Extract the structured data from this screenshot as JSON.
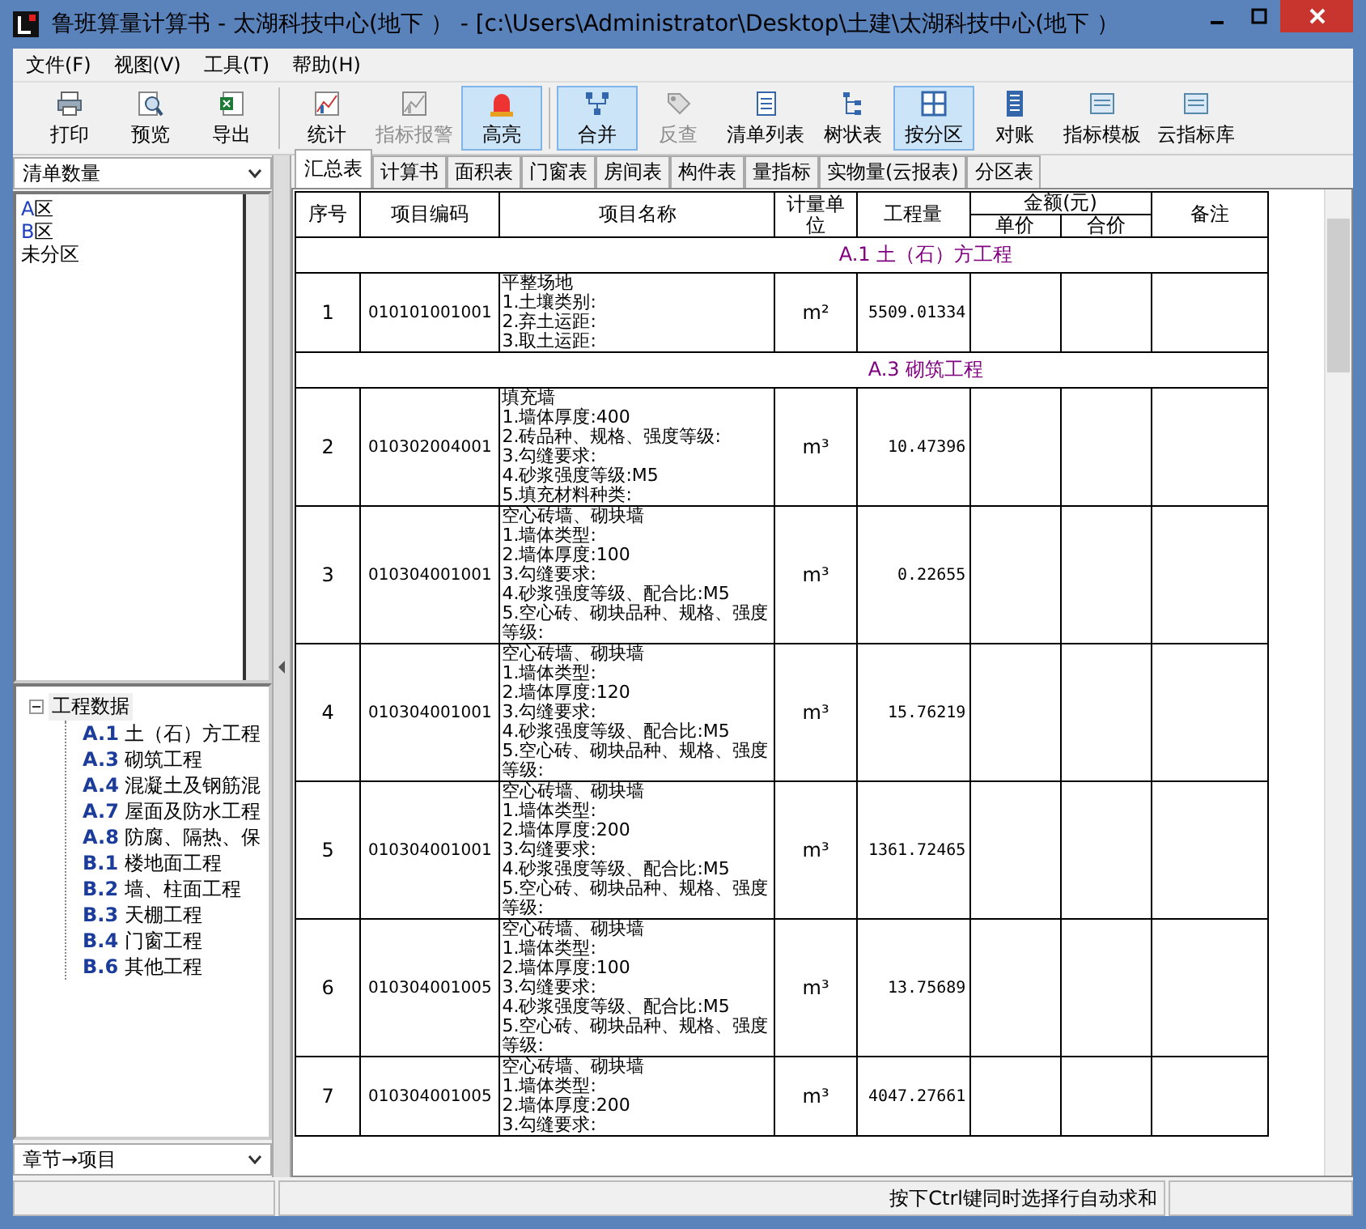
{
  "window": {
    "title": "鲁班算量计算书 - 太湖科技中心(地下 ）  - [c:\\Users\\Administrator\\Desktop\\土建\\太湖科技中心(地下 ）"
  },
  "menu": [
    "文件(F)",
    "视图(V)",
    "工具(T)",
    "帮助(H)"
  ],
  "toolbar": [
    {
      "label": "打印",
      "selected": false,
      "disabled": false,
      "group_start": false
    },
    {
      "label": "预览",
      "selected": false,
      "disabled": false,
      "group_start": false
    },
    {
      "label": "导出",
      "selected": false,
      "disabled": false,
      "group_start": false
    },
    {
      "label": "统计",
      "selected": false,
      "disabled": false,
      "group_start": true
    },
    {
      "label": "指标报警",
      "selected": false,
      "disabled": true,
      "group_start": false
    },
    {
      "label": "高亮",
      "selected": true,
      "disabled": false,
      "group_start": false
    },
    {
      "label": "合并",
      "selected": true,
      "disabled": false,
      "group_start": true
    },
    {
      "label": "反查",
      "selected": false,
      "disabled": true,
      "group_start": false
    },
    {
      "label": "清单列表",
      "selected": false,
      "disabled": false,
      "group_start": false
    },
    {
      "label": "树状表",
      "selected": false,
      "disabled": false,
      "group_start": false
    },
    {
      "label": "按分区",
      "selected": true,
      "disabled": false,
      "group_start": false
    },
    {
      "label": "对账",
      "selected": false,
      "disabled": false,
      "group_start": false
    },
    {
      "label": "指标模板",
      "selected": false,
      "disabled": false,
      "group_start": false
    },
    {
      "label": "云指标库",
      "selected": false,
      "disabled": false,
      "group_start": false
    }
  ],
  "sidebar": {
    "dropdown": "清单数量",
    "zones": [
      {
        "code": "A",
        "label": "区"
      },
      {
        "code": "B",
        "label": "区"
      },
      {
        "label": "未分区"
      }
    ],
    "tree": {
      "label": "工程数据",
      "expanded": true,
      "children": [
        {
          "code": "A.1",
          "label": "土（石）方工程"
        },
        {
          "code": "A.3",
          "label": "砌筑工程"
        },
        {
          "code": "A.4",
          "label": "混凝土及钢筋混"
        },
        {
          "code": "A.7",
          "label": "屋面及防水工程"
        },
        {
          "code": "A.8",
          "label": "防腐、隔热、保"
        },
        {
          "code": "B.1",
          "label": "楼地面工程"
        },
        {
          "code": "B.2",
          "label": "墙、柱面工程"
        },
        {
          "code": "B.3",
          "label": "天棚工程"
        },
        {
          "code": "B.4",
          "label": "门窗工程"
        },
        {
          "code": "B.6",
          "label": "其他工程"
        }
      ]
    },
    "bottom_dropdown": "章节→项目"
  },
  "tabs": [
    {
      "label": "汇总表",
      "selected": true
    },
    {
      "label": "计算书",
      "selected": false
    },
    {
      "label": "面积表",
      "selected": false
    },
    {
      "label": "门窗表",
      "selected": false
    },
    {
      "label": "房间表",
      "selected": false
    },
    {
      "label": "构件表",
      "selected": false
    },
    {
      "label": "量指标",
      "selected": false
    },
    {
      "label": "实物量(云报表)",
      "selected": false
    },
    {
      "label": "分区表",
      "selected": false
    }
  ],
  "table": {
    "columns": [
      "序号",
      "项目编码",
      "项目名称",
      "计量单位",
      "工程量",
      "金额(元)",
      "备注"
    ],
    "subcolumns": [
      "单价",
      "合价"
    ],
    "rows": [
      {
        "kind": "section",
        "title": "A.1 土（石）方工程"
      },
      {
        "kind": "item",
        "no": "1",
        "code": "010101001001",
        "name": "平整场地\n1.土壤类别:\n2.弃土运距:\n3.取土运距:",
        "unit": "m²",
        "qty": "5509.01334"
      },
      {
        "kind": "section",
        "title": "A.3 砌筑工程"
      },
      {
        "kind": "item",
        "no": "2",
        "code": "010302004001",
        "name": "填充墙\n1.墙体厚度:400\n2.砖品种、规格、强度等级:\n3.勾缝要求:\n4.砂浆强度等级:M5\n5.填充材料种类:",
        "unit": "m³",
        "qty": "10.47396"
      },
      {
        "kind": "item",
        "no": "3",
        "code": "010304001001",
        "name": "空心砖墙、砌块墙\n1.墙体类型:\n2.墙体厚度:100\n3.勾缝要求:\n4.砂浆强度等级、配合比:M5\n5.空心砖、砌块品种、规格、强度等级:",
        "unit": "m³",
        "qty": "0.22655"
      },
      {
        "kind": "item",
        "no": "4",
        "code": "010304001001",
        "name": "空心砖墙、砌块墙\n1.墙体类型:\n2.墙体厚度:120\n3.勾缝要求:\n4.砂浆强度等级、配合比:M5\n5.空心砖、砌块品种、规格、强度等级:",
        "unit": "m³",
        "qty": "15.76219"
      },
      {
        "kind": "item",
        "no": "5",
        "code": "010304001001",
        "name": "空心砖墙、砌块墙\n1.墙体类型:\n2.墙体厚度:200\n3.勾缝要求:\n4.砂浆强度等级、配合比:M5\n5.空心砖、砌块品种、规格、强度等级:",
        "unit": "m³",
        "qty": "1361.72465"
      },
      {
        "kind": "item",
        "no": "6",
        "code": "010304001005",
        "name": "空心砖墙、砌块墙\n1.墙体类型:\n2.墙体厚度:100\n3.勾缝要求:\n4.砂浆强度等级、配合比:M5\n5.空心砖、砌块品种、规格、强度等级:",
        "unit": "m³",
        "qty": "13.75689"
      },
      {
        "kind": "item",
        "no": "7",
        "code": "010304001005",
        "name": "空心砖墙、砌块墙\n1.墙体类型:\n2.墙体厚度:200\n3.勾缝要求:",
        "unit": "m³",
        "qty": "4047.27661"
      }
    ]
  },
  "status_bar": {
    "hint": "按下Ctrl键同时选择行自动求和"
  }
}
